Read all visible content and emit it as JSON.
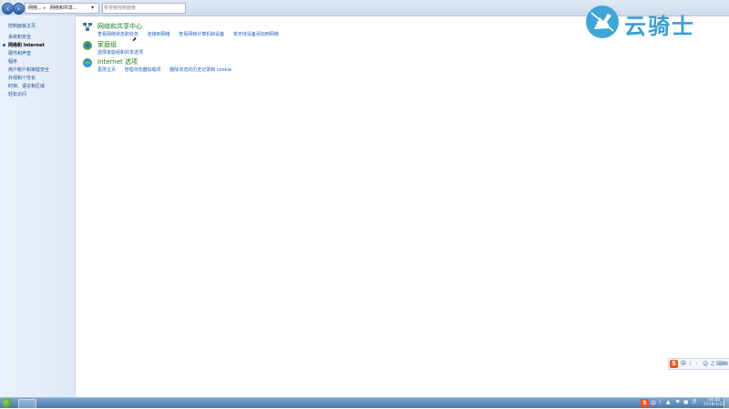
{
  "addressbar": {
    "crumbs": [
      "网络...",
      "网络和共享..."
    ],
    "search_placeholder": "搜索控制面板"
  },
  "sidebar": {
    "items": [
      {
        "label": "控制面板主页",
        "active": false
      },
      {
        "label": "系统和安全",
        "active": false
      },
      {
        "label": "网络和 Internet",
        "active": true
      },
      {
        "label": "硬件和声音",
        "active": false
      },
      {
        "label": "程序",
        "active": false
      },
      {
        "label": "用户帐户和家庭安全",
        "active": false
      },
      {
        "label": "外观和个性化",
        "active": false
      },
      {
        "label": "时钟、语言和区域",
        "active": false
      },
      {
        "label": "轻松访问",
        "active": false
      }
    ]
  },
  "main": {
    "categories": [
      {
        "title": "网络和共享中心",
        "icon": "network-center-icon",
        "links": [
          "查看网络状态和任务",
          "连接到网络",
          "查看网络计算机和设备",
          "将无线设备添加到网络"
        ]
      },
      {
        "title": "家庭组",
        "icon": "homegroup-icon",
        "links": [
          "选择家庭组和共享选项"
        ]
      },
      {
        "title": "Internet 选项",
        "icon": "internet-options-icon",
        "links": [
          "更改主页",
          "管理浏览器加载项",
          "删除浏览的历史记录和 cookie"
        ]
      }
    ]
  },
  "logo": {
    "text": "云骑士"
  },
  "ime": {
    "brand": "S",
    "mode": "中"
  },
  "taskbar": {
    "tray_brand": "S",
    "tray_mode": "中",
    "time": "14:32",
    "date": "2019/1/22"
  },
  "colors": {
    "link": "#1f5fbf",
    "category_title": "#1f7a1f",
    "taskbar": "#4b78a8",
    "logo": "#3a9fd4"
  }
}
